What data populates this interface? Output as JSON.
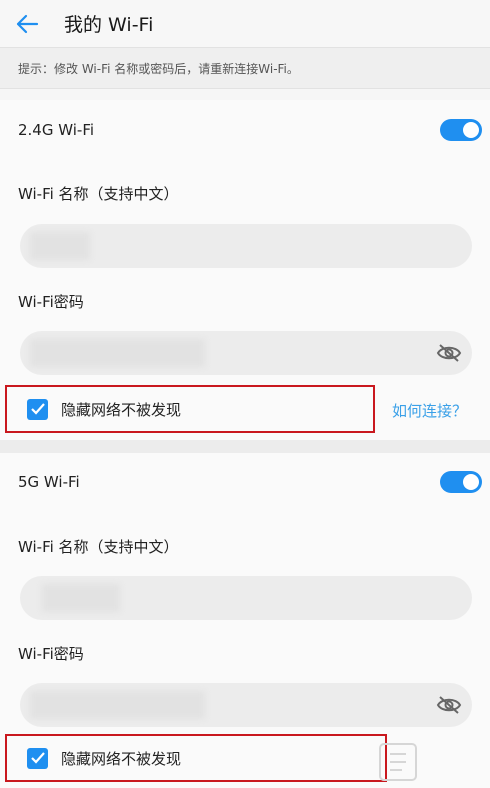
{
  "header": {
    "title": "我的 Wi-Fi",
    "back_icon": "arrow-left-icon"
  },
  "tip": "提示：修改 Wi-Fi 名称或密码后，请重新连接Wi-Fi。",
  "band_24": {
    "label": "2.4G Wi-Fi",
    "enabled": true,
    "name_label": "Wi-Fi 名称（支持中文）",
    "password_label": "Wi-Fi密码",
    "hide_label": "隐藏网络不被发现",
    "hide_checked": true,
    "help_link": "如何连接？"
  },
  "band_5": {
    "label": "5G Wi-Fi",
    "enabled": true,
    "name_label": "Wi-Fi 名称（支持中文）",
    "password_label": "Wi-Fi密码",
    "hide_label": "隐藏网络不被发现",
    "hide_checked": true
  },
  "colors": {
    "accent": "#1f8ff0",
    "link": "#3aa0e8",
    "highlight_border": "#c9181e"
  }
}
